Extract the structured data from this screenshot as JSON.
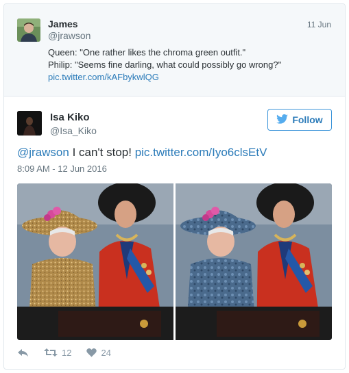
{
  "parent_tweet": {
    "name": "James",
    "handle": "@jrawson",
    "date": "11 Jun",
    "line1": "Queen: \"One rather likes the chroma green outfit.\"",
    "line2": "Philip: \"Seems fine darling, what could possibly go wrong?\"",
    "link": "pic.twitter.com/kAFbykwlQG"
  },
  "tweet": {
    "name": "Isa Kiko",
    "handle": "@Isa_Kiko",
    "follow_label": "Follow",
    "mention": "@jrawson",
    "text": " I can't stop! ",
    "link": "pic.twitter.com/Iyo6clsEtV",
    "timestamp": "8:09 AM - 12 Jun 2016",
    "retweets": "12",
    "likes": "24"
  },
  "colors": {
    "link": "#2b7bb9",
    "muted": "#66757f",
    "border": "#e1e8ed",
    "parent_bg": "#f5f8fa"
  },
  "icons": [
    "twitter-bird-icon",
    "reply-icon",
    "retweet-icon",
    "heart-icon"
  ]
}
